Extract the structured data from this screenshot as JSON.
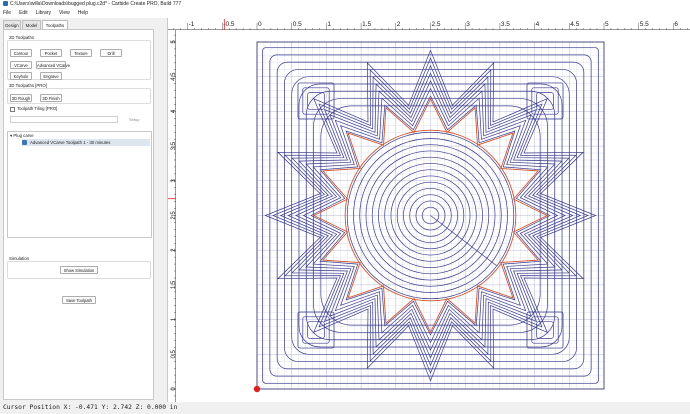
{
  "window": {
    "title": "C:\\Users\\willa\\Downloads\\bugged plug.c2d* - Carbide Create PRO, Build 777"
  },
  "menu": [
    "File",
    "Edit",
    "Library",
    "View",
    "Help"
  ],
  "tabs": [
    {
      "label": "Design",
      "active": false
    },
    {
      "label": "Model",
      "active": false
    },
    {
      "label": "Toolpaths",
      "active": true
    }
  ],
  "toolpaths_2d": {
    "title": "2D Toolpaths",
    "buttons": [
      "Contour",
      "Pocket",
      "Texture",
      "Drill",
      "VCarve",
      "Advanced VCarve",
      "Keyhole",
      "Engrave"
    ]
  },
  "toolpaths_3d": {
    "title": "3D Toolpaths [PRO]",
    "buttons": [
      "3D Rough",
      "3D Finish"
    ]
  },
  "tiling": {
    "label": "Toolpath Tiling [PRO]",
    "checked": false
  },
  "current_tile": {
    "label": "Current Tile",
    "setup_label": "Setup"
  },
  "tree": {
    "group": "Plug carve",
    "item": "Advanced VCarve Toolpath 1 - 30 minutes"
  },
  "simulation": {
    "title": "Simulation",
    "button": "Show Simulation"
  },
  "save_button": "Save Toolpath",
  "status": {
    "text": "Cursor Position X: -0.471 Y: 2.742 Z: 0.000 in"
  },
  "ruler": {
    "x_labels": [
      "-1",
      "-0.5",
      "0",
      "0.5",
      "1",
      "1.5",
      "2",
      "2.5",
      "3",
      "3.5",
      "4",
      "4.5",
      "5",
      "5.5",
      "6"
    ],
    "y_labels": [
      "5",
      "4.5",
      "4",
      "3.5",
      "3",
      "2.5",
      "2",
      "1.5",
      "1",
      "0.5",
      "0"
    ],
    "cursor_x": -0.471,
    "cursor_y": 2.742
  },
  "design": {
    "stock_width_in": 5,
    "stock_height_in": 5,
    "star_points": 16,
    "units": "in"
  },
  "colors": {
    "toolpath": "#3a3a8a",
    "grid_major": "#b4b8d6",
    "grid_minor": "#dfe2ee",
    "vector_outline": "#d2552e",
    "cursor_marker": "#e02020"
  }
}
